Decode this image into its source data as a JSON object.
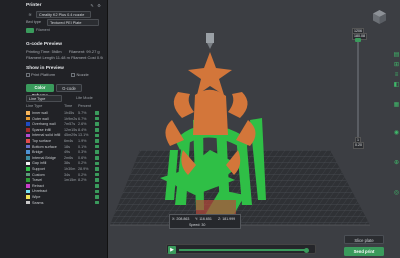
{
  "printer": {
    "section_title": "Printer",
    "printer_name": "Creality K2 Plus 0.4 nozzle",
    "bed_type_label": "Bed type",
    "bed_type_value": "Textured PEI Plate",
    "filament_tab_label": "Filament"
  },
  "gcode_preview": {
    "title": "G-code Preview",
    "printing_time_label": "Printing Time:",
    "printing_time_value": "5h8m",
    "filament_label": "Filament:",
    "filament_value": "99.27 g",
    "weight_text": "Filament Length 11.48 m  Filament Cost 0.98"
  },
  "show_in_preview": {
    "title": "Show in Preview",
    "print_platform_label": "Print Platform",
    "nozzle_label": "Nozzle",
    "color_scheme_label": "Color Scheme",
    "gcode_label": "G-code",
    "line_type_dropdown": "Line Type",
    "lite_mode_label": "Lite Mode"
  },
  "legend": {
    "headers": [
      "Line Type",
      "Time",
      "Percent"
    ],
    "items": [
      {
        "name": "Inner wall",
        "time": "1h45s",
        "pct": "5.7%",
        "color": "#f8b55a"
      },
      {
        "name": "Outer wall",
        "time": "1h9m2s",
        "pct": "6.7%",
        "color": "#e79a31"
      },
      {
        "name": "Overhang wall",
        "time": "7m57s",
        "pct": "2.6%",
        "color": "#1f4bc1"
      },
      {
        "name": "Sparse infill",
        "time": "12m15s",
        "pct": "8.4%",
        "color": "#a62a2a"
      },
      {
        "name": "Internal solid infill",
        "time": "45m29s",
        "pct": "13.1%",
        "color": "#b24ccf"
      },
      {
        "name": "Top surface",
        "time": "6m4s",
        "pct": "1.9%",
        "color": "#e34c4c"
      },
      {
        "name": "Bottom surface",
        "time": "18s",
        "pct": "0.1%",
        "color": "#6a72ca"
      },
      {
        "name": "Bridge",
        "time": "49s",
        "pct": "0.3%",
        "color": "#4f93d6"
      },
      {
        "name": "Internal Bridge",
        "time": "2m6s",
        "pct": "0.6%",
        "color": "#3e8ea2"
      },
      {
        "name": "Gap infill",
        "time": "38s",
        "pct": "0.2%",
        "color": "#f2f2f2"
      },
      {
        "name": "Support",
        "time": "1h30m",
        "pct": "28.9%",
        "color": "#2fbf46"
      },
      {
        "name": "Custom",
        "time": "34s",
        "pct": "0.2%",
        "color": "#5c9e7c"
      },
      {
        "name": "Travel",
        "time": "1m15m",
        "pct": "8.2%",
        "color": "#2f9f35"
      },
      {
        "name": "Retract",
        "time": "",
        "pct": "",
        "color": "#c93fc9"
      },
      {
        "name": "Unretract",
        "time": "",
        "pct": "",
        "color": "#77e2f2"
      },
      {
        "name": "Wipe",
        "time": "",
        "pct": "",
        "color": "#f0e55b"
      },
      {
        "name": "Seams",
        "time": "",
        "pct": "",
        "color": "#c9c9c9"
      }
    ]
  },
  "layer_slider": {
    "top_value": "1206",
    "top_sub": "180.08",
    "bottom_value": "1",
    "bottom_sub": "0.20"
  },
  "coords_box": {
    "x": "X: 208.863",
    "y": "Y: 116.651",
    "z": "Z: 181.999",
    "speed": "Speed: 30"
  },
  "actions": {
    "slice_plate": "Slice plate",
    "send_print": "Send print"
  },
  "colors": {
    "accent": "#3a9b5c",
    "support_green": "#2fbf46",
    "model_orange": "#d3763a",
    "panel_bg": "#212226",
    "viewport_bg": "#3c3e43"
  }
}
